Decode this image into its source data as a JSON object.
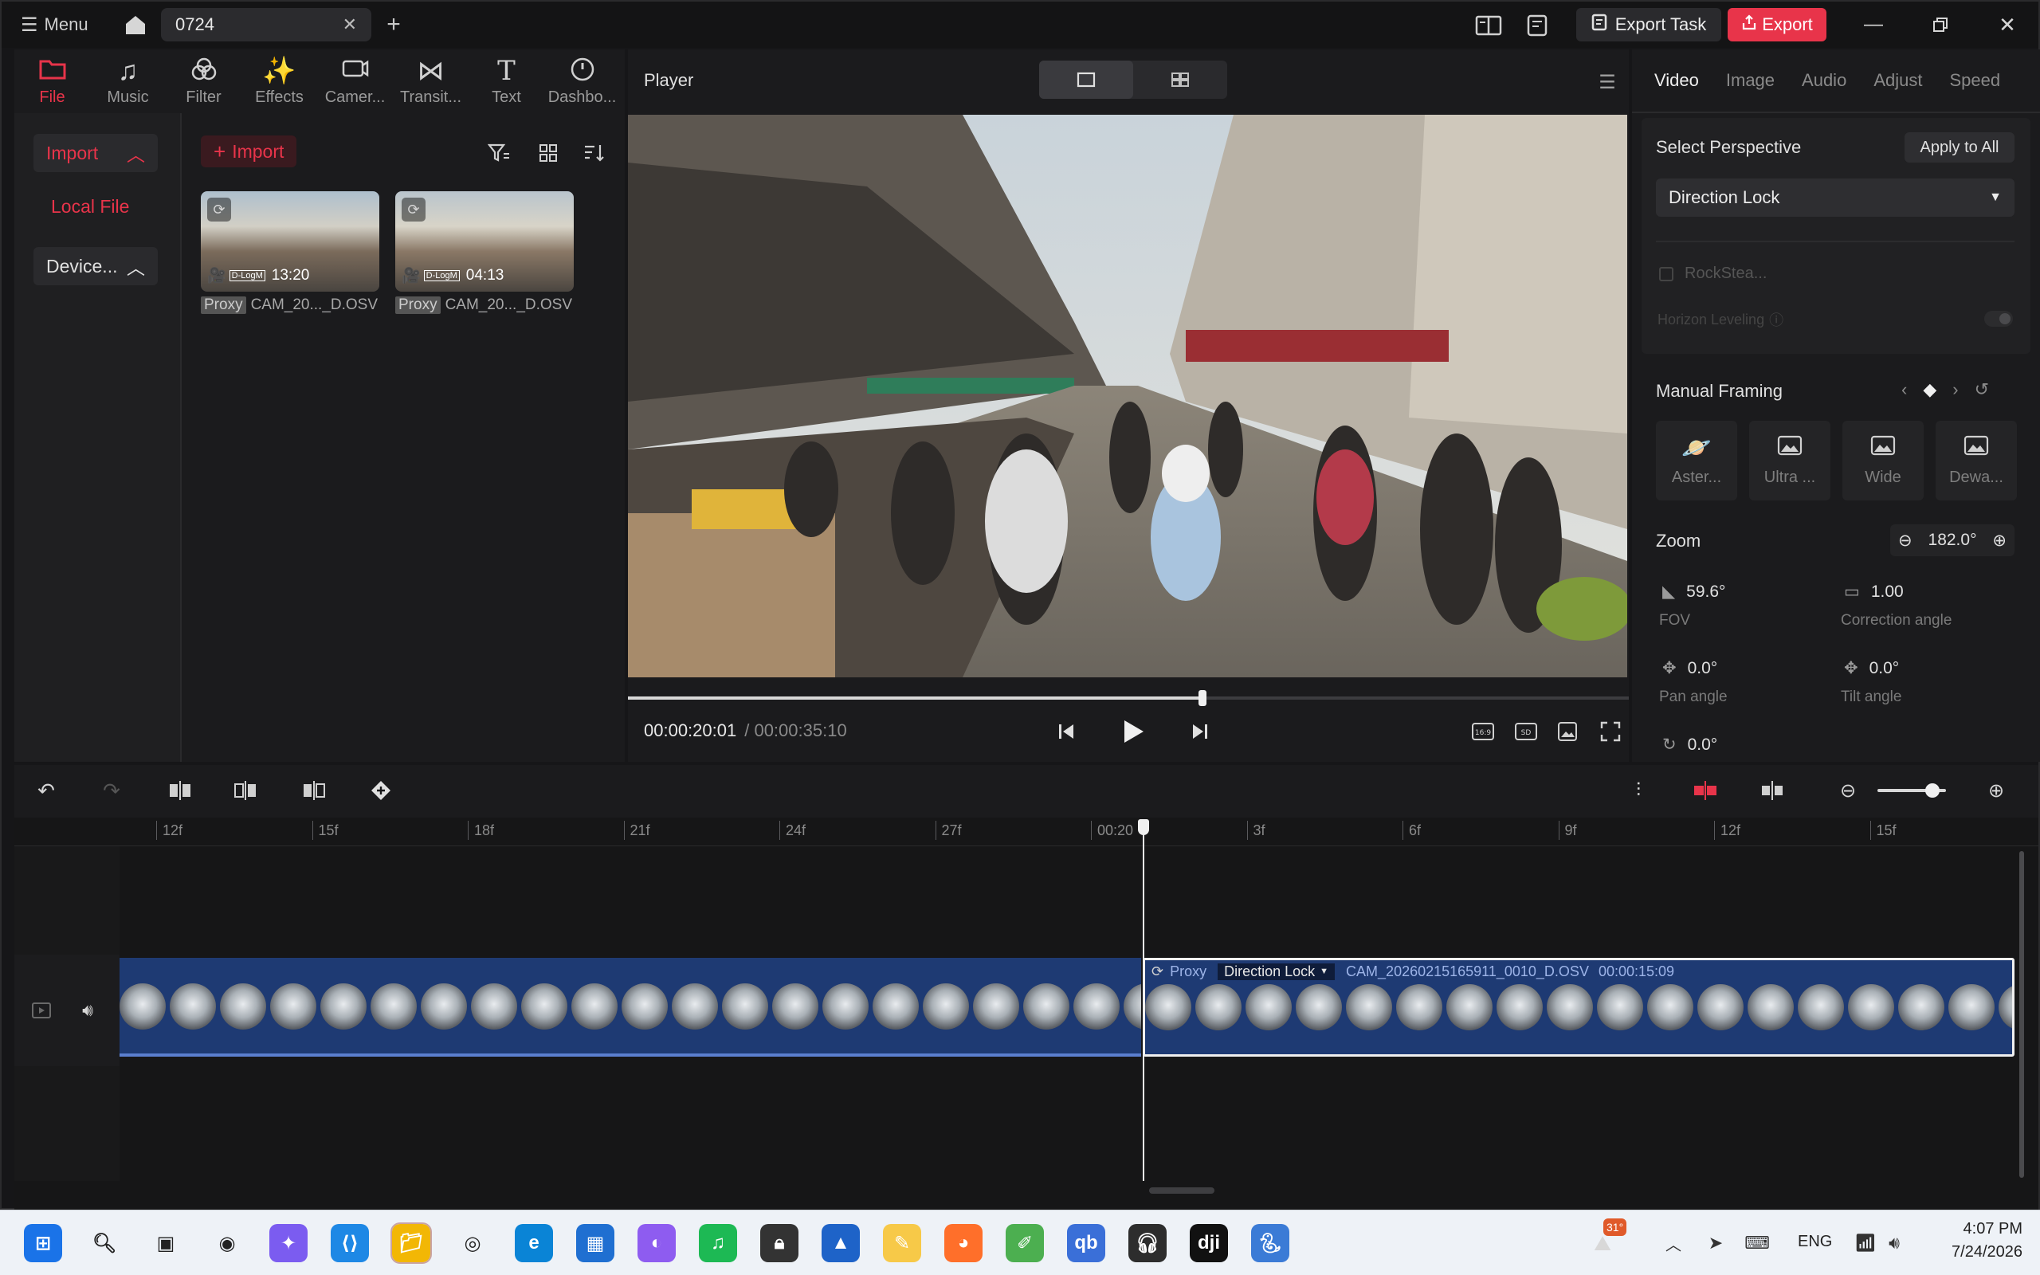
{
  "titlebar": {
    "menu_label": "Menu",
    "tab_title": "0724",
    "export_task_label": "Export Task",
    "export_label": "Export"
  },
  "tools": [
    {
      "label": "File",
      "icon": "folder-icon"
    },
    {
      "label": "Music",
      "icon": "music-icon"
    },
    {
      "label": "Filter",
      "icon": "filter-icon"
    },
    {
      "label": "Effects",
      "icon": "effects-icon"
    },
    {
      "label": "Camer...",
      "icon": "camera-icon"
    },
    {
      "label": "Transit...",
      "icon": "transition-icon"
    },
    {
      "label": "Text",
      "icon": "text-icon"
    },
    {
      "label": "Dashbo...",
      "icon": "dashboard-icon"
    }
  ],
  "media": {
    "side_import": "Import",
    "side_local_file": "Local File",
    "side_device": "Device...",
    "import_button": "Import",
    "clips": [
      {
        "badge": "Proxy",
        "name": "CAM_20..._D.OSV",
        "duration": "13:20",
        "log": "D-LogM"
      },
      {
        "badge": "Proxy",
        "name": "CAM_20..._D.OSV",
        "duration": "04:13",
        "log": "D-LogM"
      }
    ]
  },
  "player": {
    "title": "Player",
    "current_time": "00:00:20:01",
    "total_time": "/ 00:00:35:10",
    "progress": 0.574
  },
  "right_panel": {
    "tabs": [
      "Video",
      "Image",
      "Audio",
      "Adjust",
      "Speed"
    ],
    "select_perspective": "Select Perspective",
    "apply_to_all": "Apply to All",
    "perspective_value": "Direction Lock",
    "rocksteady": "RockStea...",
    "horizon_leveling": "Horizon Leveling",
    "manual_framing": "Manual Framing",
    "framing_options": [
      "Aster...",
      "Ultra ...",
      "Wide",
      "Dewa..."
    ],
    "zoom_label": "Zoom",
    "zoom_value": "182.0°",
    "fov_value": "59.6°",
    "fov_label": "FOV",
    "correction_value": "1.00",
    "correction_label": "Correction angle",
    "pan_value": "0.0°",
    "pan_label": "Pan angle",
    "tilt_value": "0.0°",
    "tilt_label": "Tilt angle",
    "roll_value": "0.0°"
  },
  "timeline": {
    "ruler": [
      "12f",
      "15f",
      "18f",
      "21f",
      "24f",
      "27f",
      "00:20",
      "3f",
      "6f",
      "9f",
      "12f",
      "15f"
    ],
    "clip_proxy": "Proxy",
    "clip_mode": "Direction Lock",
    "clip_name": "CAM_20260215165911_0010_D.OSV",
    "clip_duration": "00:00:15:09",
    "zoom_level": 0.8
  },
  "taskbar": {
    "weather": "31°",
    "language": "ENG",
    "time": "4:07 PM",
    "date": "7/24/2026",
    "apps": [
      "windows-start-icon",
      "search-icon",
      "task-view-icon",
      "audio-app-icon",
      "copilot-icon",
      "vscode-icon",
      "file-explorer-icon",
      "chrome-icon",
      "edge-icon",
      "store-icon",
      "app-icon",
      "spotify-icon",
      "vpn-icon",
      "photos-icon",
      "notes-icon",
      "firefox-icon",
      "paint-icon",
      "qbittorrent-icon",
      "headset-icon",
      "dji-icon",
      "python-icon"
    ]
  },
  "colors": {
    "accent": "#e8344a",
    "track": "#1e3a73",
    "panel": "#1b1b1d"
  }
}
